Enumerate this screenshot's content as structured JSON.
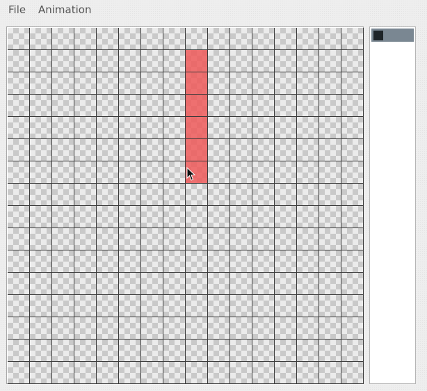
{
  "menubar": {
    "items": [
      {
        "id": "file",
        "label": "File"
      },
      {
        "id": "animation",
        "label": "Animation"
      }
    ]
  },
  "canvas": {
    "columns": 16,
    "rows": 16,
    "paint_color": "#ef5a5a",
    "painted_cells": [
      {
        "col": 8,
        "row": 1
      },
      {
        "col": 8,
        "row": 2
      },
      {
        "col": 8,
        "row": 3
      },
      {
        "col": 8,
        "row": 4
      },
      {
        "col": 8,
        "row": 5
      },
      {
        "col": 8,
        "row": 6
      }
    ]
  },
  "frames_panel": {
    "frames": [
      {
        "selected": true
      }
    ]
  },
  "colors": {
    "grid_line": "#3a3a3a",
    "checker_light": "#ebebeb",
    "checker_dark": "#c9c9c9",
    "frame_thumb_bg": "#7a8792",
    "frame_thumb_swatch": "#1e2428"
  }
}
